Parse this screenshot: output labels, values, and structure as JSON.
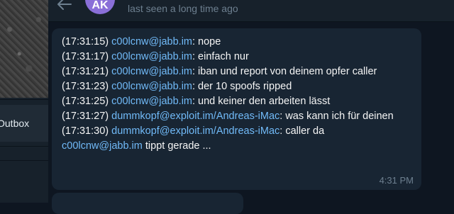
{
  "sidebar": {
    "outbox_label": "Outbox"
  },
  "header": {
    "avatar_initials": "AK",
    "status": "last seen a long time ago"
  },
  "messages": [
    {
      "time": "(17:31:15)",
      "sender": "c00lcnw@jabb.im",
      "text": ": nope"
    },
    {
      "time": "(17:31:17)",
      "sender": "c00lcnw@jabb.im",
      "text": ": einfach nur"
    },
    {
      "time": "(17:31:21)",
      "sender": "c00lcnw@jabb.im",
      "text": ": iban und report von deinem opfer caller"
    },
    {
      "time": "(17:31:23)",
      "sender": "c00lcnw@jabb.im",
      "text": ": der 10 spoofs ripped"
    },
    {
      "time": "(17:31:25)",
      "sender": "c00lcnw@jabb.im",
      "text": ": und keiner den arbeiten lässt"
    },
    {
      "time": "(17:31:27)",
      "sender": "dummkopf@exploit.im/Andreas-iMac",
      "text": ": was kann ich für deinen"
    },
    {
      "time": "(17:31:30)",
      "sender": "dummkopf@exploit.im/Andreas-iMac",
      "text": ": caller da"
    }
  ],
  "typing": {
    "sender": "c00lcnw@jabb.im",
    "text": " tippt gerade ..."
  },
  "bubble_timestamp": "4:31 PM"
}
